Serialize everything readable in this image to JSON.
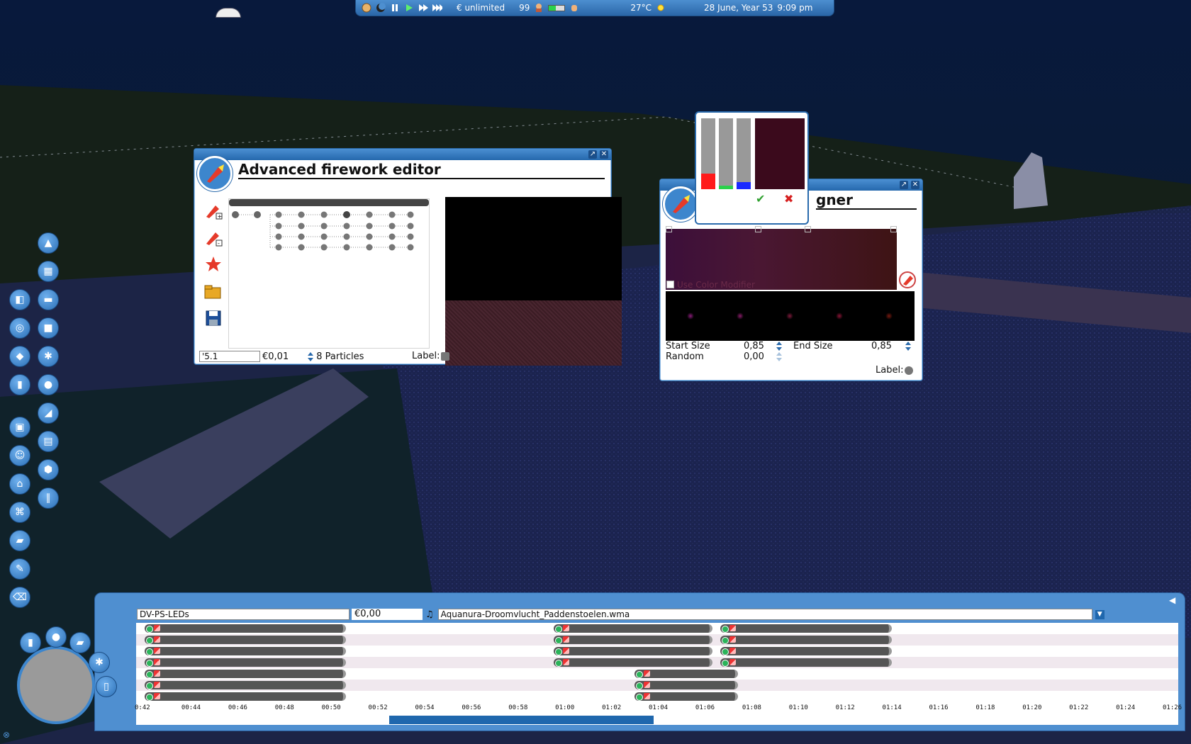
{
  "topbar": {
    "money": "€ unlimited",
    "guests": "99",
    "temperature": "27°C",
    "date": "28 June, Year 53",
    "time": "9:09 pm"
  },
  "firework_editor": {
    "title": "Advanced firework editor",
    "name_value": "'5.1",
    "cost": "€0,01",
    "particles": "8 Particles",
    "label_text": "Label:"
  },
  "particle_designer": {
    "title_visible": "gner",
    "use_color_modifier": "Use Color Modifier",
    "start_size_label": "Start Size",
    "start_size_value": "0,85",
    "end_size_label": "End Size",
    "end_size_value": "0,85",
    "random_label": "Random",
    "random_value": "0,00",
    "label_text": "Label:",
    "particle_colors": [
      "#8a1c7a",
      "#8a1c6a",
      "#7e1a3c",
      "#8a1436",
      "#7a1a10"
    ]
  },
  "color_picker": {
    "red_level": 0.22,
    "green_level": 0.05,
    "blue_level": 0.1,
    "swatch_color": "#3b0a1c"
  },
  "timeline": {
    "show_name": "DV-PS-LEDs",
    "cost": "€0,00",
    "music_file": "Aquanura-Droomvlucht_Paddenstoelen.wma",
    "ticks": [
      "0:42",
      "00:44",
      "00:46",
      "00:48",
      "00:50",
      "00:52",
      "00:54",
      "00:56",
      "00:58",
      "01:00",
      "01:02",
      "01:04",
      "01:06",
      "01:08",
      "01:10",
      "01:12",
      "01:14",
      "01:16",
      "01:18",
      "01:20",
      "01:22",
      "01:24",
      "01:26"
    ]
  }
}
